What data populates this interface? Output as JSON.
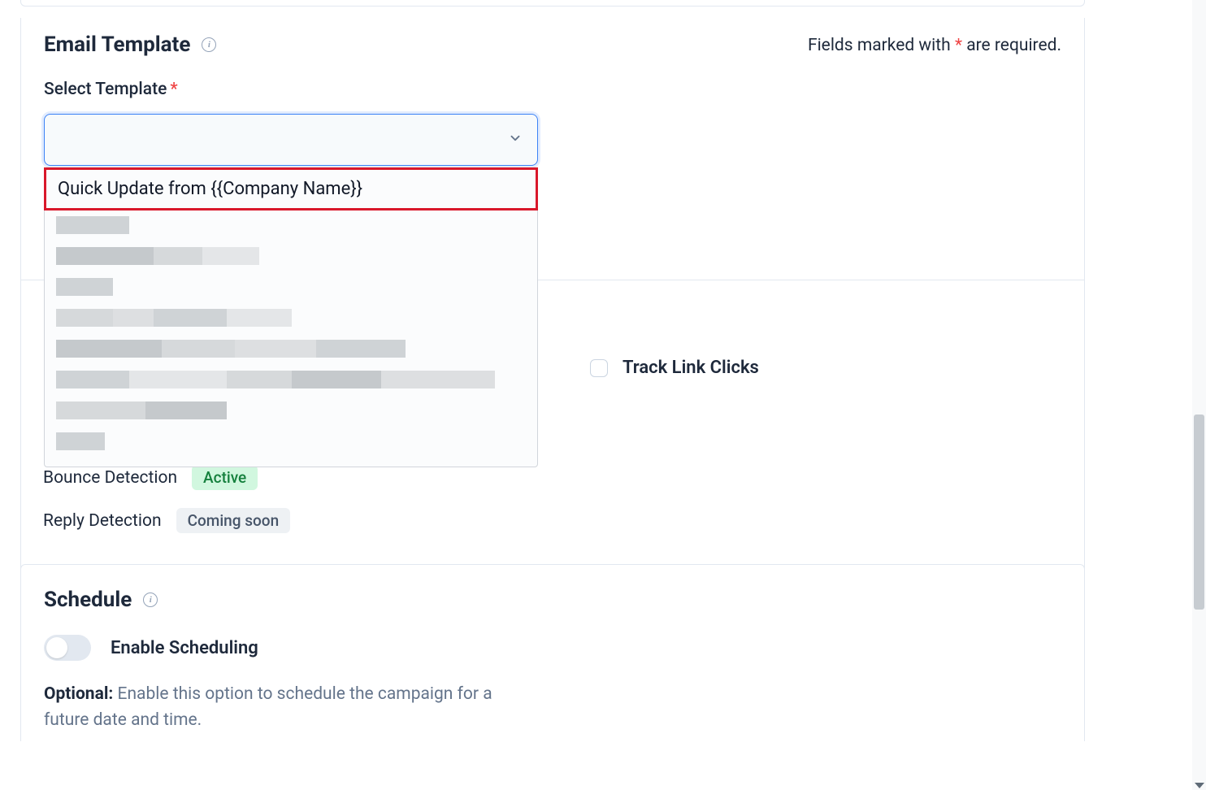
{
  "email_template": {
    "heading": "Email Template",
    "required_note_prefix": "Fields marked with ",
    "required_note_star": "*",
    "required_note_suffix": " are required.",
    "select_label": "Select Template",
    "select_star": "*",
    "select_value": "",
    "dropdown_options": {
      "0": "Quick Update from {{Company Name}}"
    }
  },
  "tracking": {
    "track_link_clicks_label": "Track Link Clicks"
  },
  "detection": {
    "bounce_label": "Bounce Detection",
    "bounce_badge": "Active",
    "reply_label": "Reply Detection",
    "reply_badge": "Coming soon"
  },
  "schedule": {
    "heading": "Schedule",
    "toggle_label": "Enable Scheduling",
    "optional_bold": "Optional:",
    "optional_text": " Enable this option to schedule the campaign for a future date and time."
  }
}
